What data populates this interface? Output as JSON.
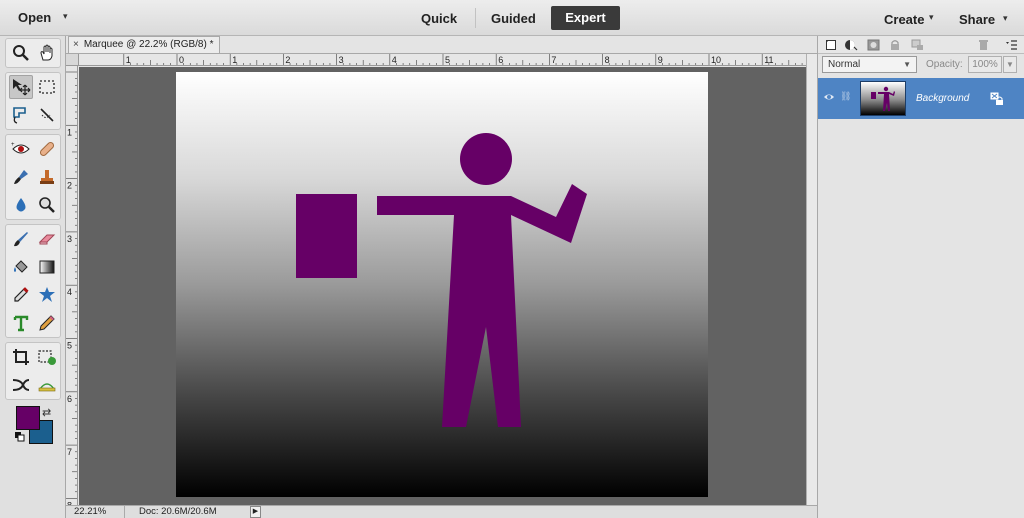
{
  "topbar": {
    "open_label": "Open",
    "open_caret": "▾",
    "modes": {
      "quick": "Quick",
      "guided": "Guided",
      "expert": "Expert"
    },
    "active_mode": "Expert",
    "create_label": "Create",
    "share_label": "Share",
    "caret": "▾"
  },
  "document": {
    "tab_close": "×",
    "tab_title": "Marquee @ 22.2% (RGB/8) *",
    "ruler_h_ticks": [
      "1",
      "0",
      "1",
      "2",
      "3",
      "4",
      "5",
      "6",
      "7",
      "8",
      "9",
      "10",
      "11"
    ],
    "ruler_v_ticks": [
      "1",
      "2",
      "3",
      "4",
      "5",
      "6",
      "7",
      "8"
    ]
  },
  "status": {
    "zoom": "22.21%",
    "doc_size": "Doc: 20.6M/20.6M",
    "arrow": "▶"
  },
  "colors": {
    "foreground": "#660066",
    "background": "#1b5f8e",
    "figure": "#660066",
    "accent_selected": "#4e84c4"
  },
  "tools": [
    "zoom-icon",
    "hand-icon",
    "move-icon",
    "rectangular-marquee-icon",
    "lasso-icon",
    "quick-selection-icon",
    "red-eye-icon",
    "spot-healing-icon",
    "smart-brush-icon",
    "clone-stamp-icon",
    "blur-icon",
    "sponge-icon",
    "brush-icon",
    "eraser-icon",
    "paint-bucket-icon",
    "gradient-icon",
    "eyedropper-icon",
    "custom-shape-icon",
    "type-icon",
    "pencil-icon",
    "crop-icon",
    "recompose-icon",
    "content-aware-move-icon",
    "straighten-icon"
  ],
  "layers": {
    "blend_mode": "Normal",
    "opacity_label": "Opacity:",
    "opacity_value": "100%",
    "items": [
      {
        "name": "Background"
      }
    ]
  }
}
